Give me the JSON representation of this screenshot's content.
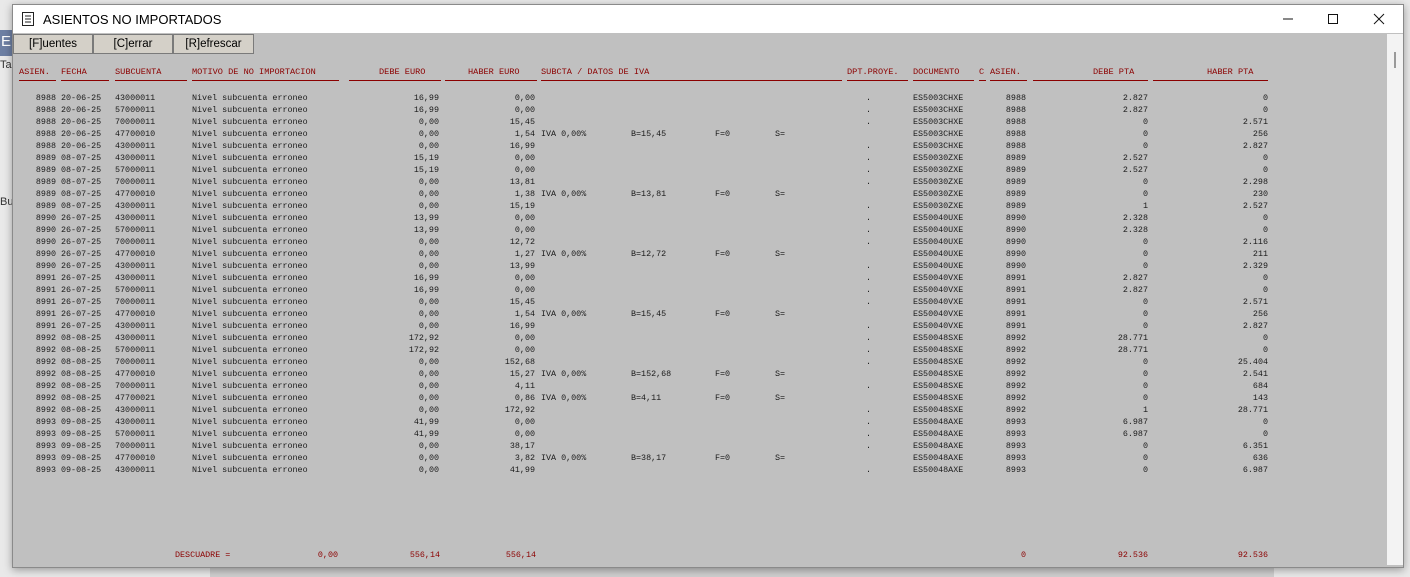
{
  "window": {
    "title": "ASIENTOS NO IMPORTADOS",
    "minimize_icon": "minimize-icon",
    "maximize_icon": "maximize-icon",
    "close_icon": "close-icon"
  },
  "background": {
    "fragment_e": "E",
    "fragment_ta": "Ta",
    "fragment_bu": "Bu"
  },
  "toolbar": {
    "fuentes": "[F]uentes",
    "cerrar": "[C]errar",
    "refrescar": "[R]efrescar"
  },
  "headers": {
    "asien": "ASIEN.",
    "fecha": "FECHA",
    "subcuenta": "SUBCUENTA",
    "motivo": "MOTIVO DE NO IMPORTACION",
    "debe_euro": "DEBE EURO",
    "haber_euro": "HABER EURO",
    "subcta_iva": "SUBCTA / DATOS DE IVA",
    "dpt": "DPT.PROYE.",
    "documento": "DOCUMENTO",
    "c": "C",
    "asien2": "ASIEN.",
    "debe_pta": "DEBE PTA",
    "haber_pta": "HABER PTA"
  },
  "rows": [
    [
      "8988",
      "20-06-25",
      "43000011",
      "Nivel subcuenta erroneo",
      "16,99",
      "0,00",
      "",
      "",
      "",
      "",
      ".",
      "ES5003CHXE",
      "8988",
      "2.827",
      "0"
    ],
    [
      "8988",
      "20-06-25",
      "57000011",
      "Nivel subcuenta erroneo",
      "16,99",
      "0,00",
      "",
      "",
      "",
      "",
      ".",
      "ES5003CHXE",
      "8988",
      "2.827",
      "0"
    ],
    [
      "8988",
      "20-06-25",
      "70000011",
      "Nivel subcuenta erroneo",
      "0,00",
      "15,45",
      "",
      "",
      "",
      "",
      ".",
      "ES5003CHXE",
      "8988",
      "0",
      "2.571"
    ],
    [
      "8988",
      "20-06-25",
      "47700010",
      "Nivel subcuenta erroneo",
      "0,00",
      "1,54",
      "IVA 0,00%",
      "B=15,45",
      "F=0",
      "S=",
      "",
      "ES5003CHXE",
      "8988",
      "0",
      "256"
    ],
    [
      "8988",
      "20-06-25",
      "43000011",
      "Nivel subcuenta erroneo",
      "0,00",
      "16,99",
      "",
      "",
      "",
      "",
      ".",
      "ES5003CHXE",
      "8988",
      "0",
      "2.827"
    ],
    [
      "8989",
      "08-07-25",
      "43000011",
      "Nivel subcuenta erroneo",
      "15,19",
      "0,00",
      "",
      "",
      "",
      "",
      ".",
      "ES50030ZXE",
      "8989",
      "2.527",
      "0"
    ],
    [
      "8989",
      "08-07-25",
      "57000011",
      "Nivel subcuenta erroneo",
      "15,19",
      "0,00",
      "",
      "",
      "",
      "",
      ".",
      "ES50030ZXE",
      "8989",
      "2.527",
      "0"
    ],
    [
      "8989",
      "08-07-25",
      "70000011",
      "Nivel subcuenta erroneo",
      "0,00",
      "13,81",
      "",
      "",
      "",
      "",
      ".",
      "ES50030ZXE",
      "8989",
      "0",
      "2.298"
    ],
    [
      "8989",
      "08-07-25",
      "47700010",
      "Nivel subcuenta erroneo",
      "0,00",
      "1,38",
      "IVA 0,00%",
      "B=13,81",
      "F=0",
      "S=",
      "",
      "ES50030ZXE",
      "8989",
      "0",
      "230"
    ],
    [
      "8989",
      "08-07-25",
      "43000011",
      "Nivel subcuenta erroneo",
      "0,00",
      "15,19",
      "",
      "",
      "",
      "",
      ".",
      "ES50030ZXE",
      "8989",
      "1",
      "2.527"
    ],
    [
      "8990",
      "26-07-25",
      "43000011",
      "Nivel subcuenta erroneo",
      "13,99",
      "0,00",
      "",
      "",
      "",
      "",
      ".",
      "ES50040UXE",
      "8990",
      "2.328",
      "0"
    ],
    [
      "8990",
      "26-07-25",
      "57000011",
      "Nivel subcuenta erroneo",
      "13,99",
      "0,00",
      "",
      "",
      "",
      "",
      ".",
      "ES50040UXE",
      "8990",
      "2.328",
      "0"
    ],
    [
      "8990",
      "26-07-25",
      "70000011",
      "Nivel subcuenta erroneo",
      "0,00",
      "12,72",
      "",
      "",
      "",
      "",
      ".",
      "ES50040UXE",
      "8990",
      "0",
      "2.116"
    ],
    [
      "8990",
      "26-07-25",
      "47700010",
      "Nivel subcuenta erroneo",
      "0,00",
      "1,27",
      "IVA 0,00%",
      "B=12,72",
      "F=0",
      "S=",
      "",
      "ES50040UXE",
      "8990",
      "0",
      "211"
    ],
    [
      "8990",
      "26-07-25",
      "43000011",
      "Nivel subcuenta erroneo",
      "0,00",
      "13,99",
      "",
      "",
      "",
      "",
      ".",
      "ES50040UXE",
      "8990",
      "0",
      "2.329"
    ],
    [
      "8991",
      "26-07-25",
      "43000011",
      "Nivel subcuenta erroneo",
      "16,99",
      "0,00",
      "",
      "",
      "",
      "",
      ".",
      "ES50040VXE",
      "8991",
      "2.827",
      "0"
    ],
    [
      "8991",
      "26-07-25",
      "57000011",
      "Nivel subcuenta erroneo",
      "16,99",
      "0,00",
      "",
      "",
      "",
      "",
      ".",
      "ES50040VXE",
      "8991",
      "2.827",
      "0"
    ],
    [
      "8991",
      "26-07-25",
      "70000011",
      "Nivel subcuenta erroneo",
      "0,00",
      "15,45",
      "",
      "",
      "",
      "",
      ".",
      "ES50040VXE",
      "8991",
      "0",
      "2.571"
    ],
    [
      "8991",
      "26-07-25",
      "47700010",
      "Nivel subcuenta erroneo",
      "0,00",
      "1,54",
      "IVA 0,00%",
      "B=15,45",
      "F=0",
      "S=",
      "",
      "ES50040VXE",
      "8991",
      "0",
      "256"
    ],
    [
      "8991",
      "26-07-25",
      "43000011",
      "Nivel subcuenta erroneo",
      "0,00",
      "16,99",
      "",
      "",
      "",
      "",
      ".",
      "ES50040VXE",
      "8991",
      "0",
      "2.827"
    ],
    [
      "8992",
      "08-08-25",
      "43000011",
      "Nivel subcuenta erroneo",
      "172,92",
      "0,00",
      "",
      "",
      "",
      "",
      ".",
      "ES50048SXE",
      "8992",
      "28.771",
      "0"
    ],
    [
      "8992",
      "08-08-25",
      "57000011",
      "Nivel subcuenta erroneo",
      "172,92",
      "0,00",
      "",
      "",
      "",
      "",
      ".",
      "ES50048SXE",
      "8992",
      "28.771",
      "0"
    ],
    [
      "8992",
      "08-08-25",
      "70000011",
      "Nivel subcuenta erroneo",
      "0,00",
      "152,68",
      "",
      "",
      "",
      "",
      ".",
      "ES50048SXE",
      "8992",
      "0",
      "25.404"
    ],
    [
      "8992",
      "08-08-25",
      "47700010",
      "Nivel subcuenta erroneo",
      "0,00",
      "15,27",
      "IVA 0,00%",
      "B=152,68",
      "F=0",
      "S=",
      "",
      "ES50048SXE",
      "8992",
      "0",
      "2.541"
    ],
    [
      "8992",
      "08-08-25",
      "70000011",
      "Nivel subcuenta erroneo",
      "0,00",
      "4,11",
      "",
      "",
      "",
      "",
      ".",
      "ES50048SXE",
      "8992",
      "0",
      "684"
    ],
    [
      "8992",
      "08-08-25",
      "47700021",
      "Nivel subcuenta erroneo",
      "0,00",
      "0,86",
      "IVA 0,00%",
      "B=4,11",
      "F=0",
      "S=",
      "",
      "ES50048SXE",
      "8992",
      "0",
      "143"
    ],
    [
      "8992",
      "08-08-25",
      "43000011",
      "Nivel subcuenta erroneo",
      "0,00",
      "172,92",
      "",
      "",
      "",
      "",
      ".",
      "ES50048SXE",
      "8992",
      "1",
      "28.771"
    ],
    [
      "8993",
      "09-08-25",
      "43000011",
      "Nivel subcuenta erroneo",
      "41,99",
      "0,00",
      "",
      "",
      "",
      "",
      ".",
      "ES50048AXE",
      "8993",
      "6.987",
      "0"
    ],
    [
      "8993",
      "09-08-25",
      "57000011",
      "Nivel subcuenta erroneo",
      "41,99",
      "0,00",
      "",
      "",
      "",
      "",
      ".",
      "ES50048AXE",
      "8993",
      "6.987",
      "0"
    ],
    [
      "8993",
      "09-08-25",
      "70000011",
      "Nivel subcuenta erroneo",
      "0,00",
      "38,17",
      "",
      "",
      "",
      "",
      ".",
      "ES50048AXE",
      "8993",
      "0",
      "6.351"
    ],
    [
      "8993",
      "09-08-25",
      "47700010",
      "Nivel subcuenta erroneo",
      "0,00",
      "3,82",
      "IVA 0,00%",
      "B=38,17",
      "F=0",
      "S=",
      "",
      "ES50048AXE",
      "8993",
      "0",
      "636"
    ],
    [
      "8993",
      "09-08-25",
      "43000011",
      "Nivel subcuenta erroneo",
      "0,00",
      "41,99",
      "",
      "",
      "",
      "",
      ".",
      "ES50048AXE",
      "8993",
      "0",
      "6.987"
    ]
  ],
  "footer": {
    "label": "DESCUADRE =",
    "descuadre": "0,00",
    "debe_euro": "556,14",
    "haber_euro": "556,14",
    "asien": "0",
    "debe_pta": "92.536",
    "haber_pta": "92.536"
  },
  "colors": {
    "header_text": "#8b0000",
    "window_bg": "#c0c0c0"
  }
}
